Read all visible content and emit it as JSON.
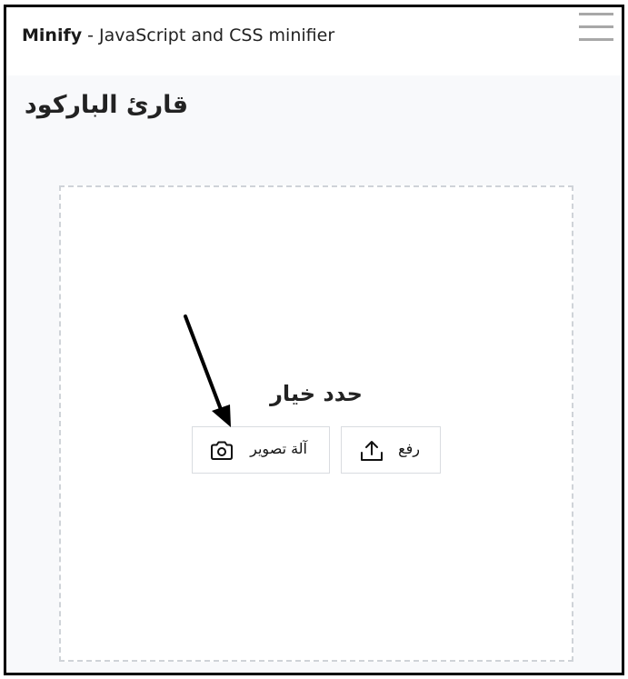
{
  "header": {
    "brand_name": "Minify",
    "brand_tagline": " - JavaScript and CSS minifier"
  },
  "page": {
    "title": "قارئ الباركود"
  },
  "dropzone": {
    "prompt": "حدد خيار",
    "camera_label": "آلة تصوير",
    "upload_label": "رفع"
  },
  "icons": {
    "menu": "hamburger-menu-icon",
    "camera": "camera-icon",
    "upload": "upload-icon"
  },
  "colors": {
    "annotation_arrow": "#000000",
    "content_background": "#f8f9fb",
    "dropzone_border": "#cfd3d8"
  }
}
